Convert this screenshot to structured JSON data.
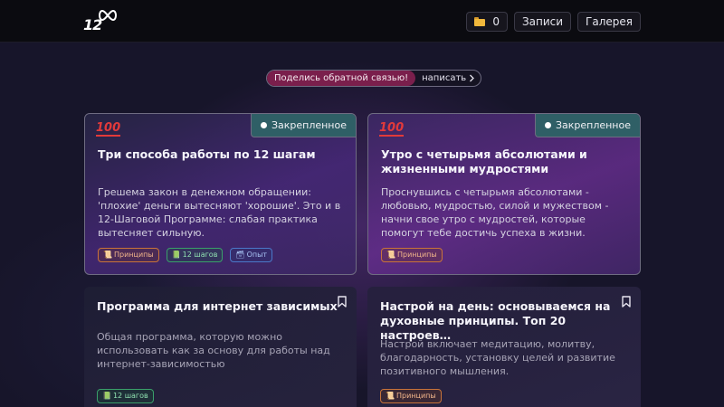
{
  "header": {
    "logo_text": "12",
    "folder_count": "0",
    "nav": {
      "entries": "Записи",
      "gallery": "Галерея"
    }
  },
  "feedback": {
    "label": "Поделись обратной связью!",
    "link": "написать"
  },
  "pinned_label": "Закрепленное",
  "emoji": "💯",
  "cards": [
    {
      "title": "Три способа работы по 12 шагам",
      "description": "Грешема закон в денежном обращении: 'плохие' деньги вытесняют 'хорошие'. Это и в 12-Шаговой Программе: слабая практика вытесняет сильную.",
      "tags": [
        "Принципы",
        "12 шагов",
        "Опыт"
      ]
    },
    {
      "title": "Утро с четырьмя абсолютами и жизненными мудростями",
      "description": "Проснувшись с четырьмя абсолютами - любовью, мудростью, силой и мужеством - начни свое утро с мудростей, которые помогут тебе достичь успеха в жизни.",
      "tags": [
        "Принципы"
      ]
    },
    {
      "title": "Программа для интернет зависимых",
      "description": "Общая программа, которую можно использовать как за основу для работы над интернет-зависимостью",
      "tags": [
        "12 шагов"
      ]
    },
    {
      "title": "Настрой на день: основываемся на духовные принципы. Топ 20 настроев…",
      "description": "Настрой включает медитацию, молитву, благодарность, установку целей и развитие позитивного мышления.",
      "tags": [
        "Принципы"
      ]
    }
  ],
  "tag_icons": {
    "principles": "📜",
    "steps": "📗",
    "experience": "🗃"
  }
}
